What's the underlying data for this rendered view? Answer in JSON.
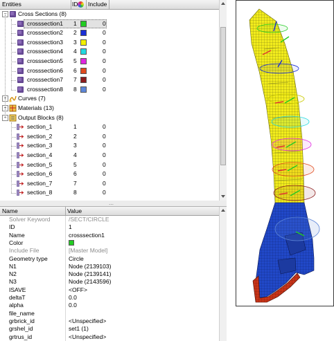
{
  "tree": {
    "headers": {
      "entities": "Entities",
      "id": "ID",
      "include": "Include"
    },
    "groups": {
      "cross_sections": "Cross Sections (8)",
      "curves": "Curves (7)",
      "materials": "Materials (13)",
      "output_blocks": "Output Blocks (8)"
    },
    "cross_sections": [
      {
        "name": "crosssection1",
        "id": "1",
        "include": "0",
        "color": "#22cc22"
      },
      {
        "name": "crosssection2",
        "id": "2",
        "include": "0",
        "color": "#1a2fd6"
      },
      {
        "name": "crosssection3",
        "id": "3",
        "include": "0",
        "color": "#f4f000"
      },
      {
        "name": "crosssection4",
        "id": "4",
        "include": "0",
        "color": "#22d8e0"
      },
      {
        "name": "crosssection5",
        "id": "5",
        "include": "0",
        "color": "#e026e0"
      },
      {
        "name": "crosssection6",
        "id": "6",
        "include": "0",
        "color": "#e04a1e"
      },
      {
        "name": "crosssection7",
        "id": "7",
        "include": "0",
        "color": "#8c1c1c"
      },
      {
        "name": "crosssection8",
        "id": "8",
        "include": "0",
        "color": "#5d86d8"
      }
    ],
    "output_blocks": [
      {
        "name": "section_1",
        "id": "1",
        "include": "0"
      },
      {
        "name": "section_2",
        "id": "2",
        "include": "0"
      },
      {
        "name": "section_3",
        "id": "3",
        "include": "0"
      },
      {
        "name": "section_4",
        "id": "4",
        "include": "0"
      },
      {
        "name": "section_5",
        "id": "5",
        "include": "0"
      },
      {
        "name": "section_6",
        "id": "6",
        "include": "0"
      },
      {
        "name": "section_7",
        "id": "7",
        "include": "0"
      },
      {
        "name": "section_8",
        "id": "8",
        "include": "0"
      }
    ]
  },
  "props": {
    "headers": {
      "name": "Name",
      "value": "Value"
    },
    "rows": [
      {
        "name": "Solver Keyword",
        "value": "/SECT/CIRCLE",
        "muted": true
      },
      {
        "name": "ID",
        "value": "1"
      },
      {
        "name": "Name",
        "value": "crosssection1"
      },
      {
        "name": "Color",
        "value": "",
        "swatch": "#22cc22"
      },
      {
        "name": "Include File",
        "value": "[Master Model]",
        "muted": true
      },
      {
        "name": "Geometry type",
        "value": "Circle"
      },
      {
        "name": "N1",
        "value": "Node (2139103)"
      },
      {
        "name": "N2",
        "value": "Node (2139141)"
      },
      {
        "name": "N3",
        "value": "Node (2143596)"
      },
      {
        "name": "ISAVE",
        "value": "<OFF>"
      },
      {
        "name": "deltaT",
        "value": "0.0"
      },
      {
        "name": "alpha",
        "value": "0.0"
      },
      {
        "name": "file_name",
        "value": ""
      },
      {
        "name": "grbrick_id",
        "value": "<Unspecified>"
      },
      {
        "name": "grshel_id",
        "value": "set1 (1)"
      },
      {
        "name": "grtrus_id",
        "value": "<Unspecified>"
      }
    ]
  },
  "colors": {
    "mesh_yellow": "#f2ec1c",
    "mesh_blue": "#2148c8",
    "mesh_red": "#c83418"
  }
}
